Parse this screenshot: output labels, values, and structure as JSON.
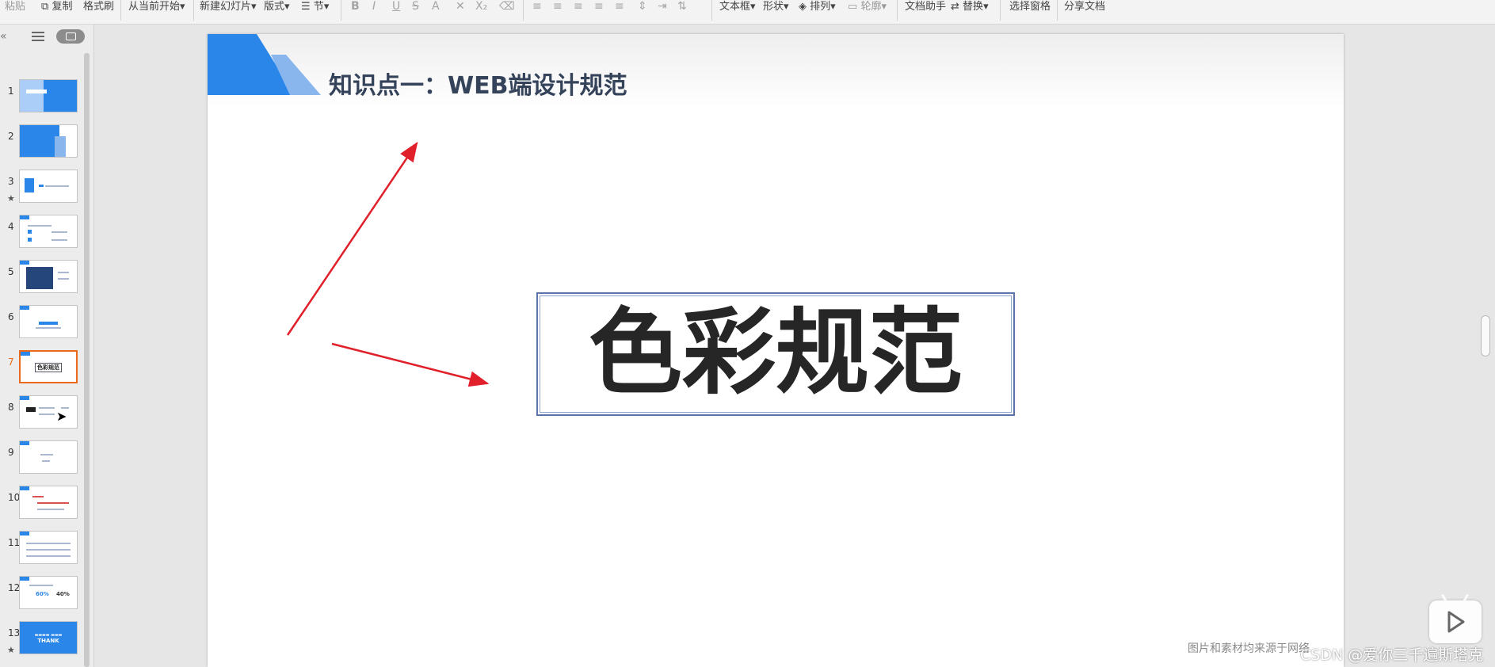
{
  "ribbon": {
    "paste": "粘贴",
    "copy": "复制",
    "format_painter": "格式刷",
    "from_current": "从当前开始",
    "new_slide": "新建幻灯片",
    "layout": "版式",
    "section": "节",
    "textbox": "文本框",
    "shape": "形状",
    "arrange": "排列",
    "outline": "轮廓",
    "doc_assistant": "文档助手",
    "replace": "替换",
    "selection_pane": "选择窗格",
    "share_doc": "分享文档"
  },
  "panel": {
    "collapse": "«",
    "current_slide": 7,
    "slides": [
      {
        "num": "1",
        "star": false
      },
      {
        "num": "2",
        "star": false
      },
      {
        "num": "3",
        "star": true
      },
      {
        "num": "4",
        "star": false
      },
      {
        "num": "5",
        "star": false
      },
      {
        "num": "6",
        "star": false
      },
      {
        "num": "7",
        "star": false
      },
      {
        "num": "8",
        "star": false
      },
      {
        "num": "9",
        "star": false
      },
      {
        "num": "10",
        "star": false
      },
      {
        "num": "11",
        "star": false
      },
      {
        "num": "12",
        "star": false
      },
      {
        "num": "13",
        "star": true
      }
    ],
    "thumb12_a": "60%",
    "thumb12_b": "40%",
    "thumb13_text": "THANK",
    "thumb7_text": "色彩规范"
  },
  "slide": {
    "title": "知识点一：WEB端设计规范",
    "main_text": "色彩规范",
    "footnote": "图片和素材均来源于网络"
  },
  "overlay": {
    "watermark": "CSDN @爱你三千遍斯塔克"
  },
  "colors": {
    "accent_blue": "#2b86ea",
    "arrow_red": "#e0202a",
    "current_orange": "#e86a1a"
  }
}
